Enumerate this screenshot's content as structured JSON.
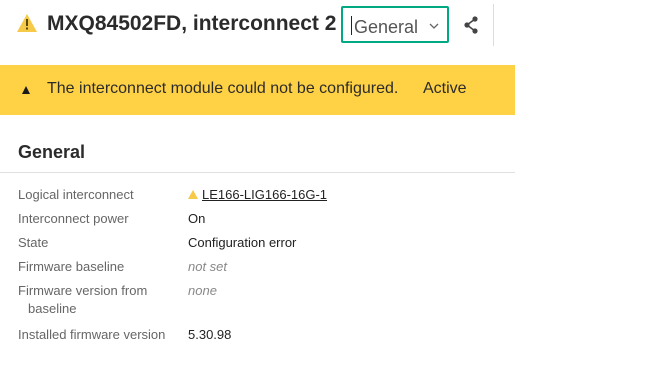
{
  "header": {
    "title": "MXQ84502FD, interconnect 2",
    "view_select_value": "General",
    "colors": {
      "accent": "#01a982",
      "warning": "#ffd144",
      "warning_icon": "#f7c948"
    }
  },
  "banner": {
    "message": "The interconnect module could not be configured.",
    "state": "Active"
  },
  "section": {
    "title": "General",
    "rows": [
      {
        "label": "Logical interconnect",
        "value": "LE166-LIG166-16G-1"
      },
      {
        "label": "Interconnect power",
        "value": "On"
      },
      {
        "label": "State",
        "value": "Configuration error"
      },
      {
        "label": "Firmware baseline",
        "value": "not set"
      },
      {
        "label_line1": "Firmware version from",
        "label_line2": "baseline",
        "value": "none"
      },
      {
        "label": "Installed firmware version",
        "value": "5.30.98"
      }
    ]
  },
  "icons": {
    "title_status": "warning-icon",
    "select_chevron": "chevron-down-icon",
    "share": "share-icon",
    "banner_status": "triangle-icon",
    "link_status": "warning-icon"
  }
}
